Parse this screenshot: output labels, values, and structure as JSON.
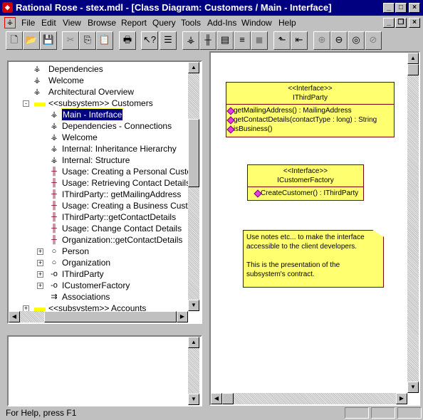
{
  "window": {
    "title": "Rational Rose - stex.mdl - [Class Diagram: Customers / Main - Interface]"
  },
  "menu": [
    "File",
    "Edit",
    "View",
    "Browse",
    "Report",
    "Query",
    "Tools",
    "Add-Ins",
    "Window",
    "Help"
  ],
  "toolbar": [
    {
      "name": "new",
      "glyph": "🗋"
    },
    {
      "name": "open",
      "glyph": "📂"
    },
    {
      "name": "save",
      "glyph": "💾"
    },
    {
      "name": "cut",
      "glyph": "✂"
    },
    {
      "name": "copy",
      "glyph": "⎘"
    },
    {
      "name": "paste",
      "glyph": "📋"
    },
    {
      "name": "print",
      "glyph": "🖶"
    },
    {
      "name": "context-help",
      "glyph": "↖?"
    },
    {
      "name": "documentation-window",
      "glyph": "☰"
    },
    {
      "name": "browse-class-diagram",
      "glyph": "⚶"
    },
    {
      "name": "browse-interaction-diagram",
      "glyph": "╫"
    },
    {
      "name": "browse-component-diagram",
      "glyph": "▤"
    },
    {
      "name": "browse-state-diagram",
      "glyph": "≡"
    },
    {
      "name": "browse-deployment-diagram",
      "glyph": "◼"
    },
    {
      "name": "browse-parent",
      "glyph": "⬑"
    },
    {
      "name": "browse-previous",
      "glyph": "⇤"
    },
    {
      "name": "zoom-in",
      "glyph": "⊕"
    },
    {
      "name": "zoom-out",
      "glyph": "⊖"
    },
    {
      "name": "fit-in-window",
      "glyph": "◎"
    },
    {
      "name": "undo-fit",
      "glyph": "⊘"
    }
  ],
  "tree": [
    {
      "label": "Dependencies",
      "icon": "class-diagram",
      "level": 1
    },
    {
      "label": "Welcome",
      "icon": "class-diagram",
      "level": 1
    },
    {
      "label": "Architectural Overview",
      "icon": "class-diagram",
      "level": 1
    },
    {
      "label": "<<subsystem>> Customers",
      "icon": "folder",
      "level": 0,
      "expander": "-"
    },
    {
      "label": "Main - Interface",
      "icon": "class-diagram",
      "level": 2,
      "selected": true
    },
    {
      "label": "Dependencies - Connections",
      "icon": "class-diagram",
      "level": 2
    },
    {
      "label": "Welcome",
      "icon": "class-diagram",
      "level": 2
    },
    {
      "label": "Internal: Inheritance Hierarchy",
      "icon": "class-diagram",
      "level": 2
    },
    {
      "label": "Internal: Structure",
      "icon": "class-diagram",
      "level": 2
    },
    {
      "label": "Usage: Creating a Personal Customer",
      "icon": "sequence-diagram",
      "level": 2
    },
    {
      "label": "Usage: Retrieving Contact Details",
      "icon": "sequence-diagram",
      "level": 2
    },
    {
      "label": "IThirdParty:: getMailingAddress",
      "icon": "sequence-diagram",
      "level": 2
    },
    {
      "label": "Usage: Creating a Business Customer",
      "icon": "sequence-diagram",
      "level": 2
    },
    {
      "label": "IThirdParty::getContactDetails",
      "icon": "sequence-diagram",
      "level": 2
    },
    {
      "label": "Usage: Change Contact Details",
      "icon": "sequence-diagram",
      "level": 2
    },
    {
      "label": "Organization::getContactDetails",
      "icon": "sequence-diagram",
      "level": 2
    },
    {
      "label": "Person",
      "icon": "class",
      "level": 2,
      "expander": "+"
    },
    {
      "label": "Organization",
      "icon": "class",
      "level": 2,
      "expander": "+"
    },
    {
      "label": "IThirdParty",
      "icon": "interface",
      "level": 2,
      "expander": "+"
    },
    {
      "label": "ICustomerFactory",
      "icon": "interface",
      "level": 2,
      "expander": "+"
    },
    {
      "label": "Associations",
      "icon": "associations",
      "level": 2
    },
    {
      "label": "<<subsystem>> Accounts",
      "icon": "folder",
      "level": 0,
      "expander": "+"
    }
  ],
  "diagram": {
    "ithirdparty": {
      "stereotype": "<<Interface>>",
      "name": "IThirdParty",
      "ops": [
        "getMailingAddress() : MailingAddress",
        "getContactDetails(contactType : long) : String",
        "isBusiness()"
      ]
    },
    "icustomerfactory": {
      "stereotype": "<<Interface>>",
      "name": "ICustomerFactory",
      "ops": [
        "CreateCustomer() : IThirdParty"
      ]
    },
    "note": {
      "line1": "Use notes etc... to make the interface accessible to the client developers.",
      "line2": "This is the presentation of the subsystem's contract."
    }
  },
  "status": {
    "text": "For Help, press F1"
  }
}
